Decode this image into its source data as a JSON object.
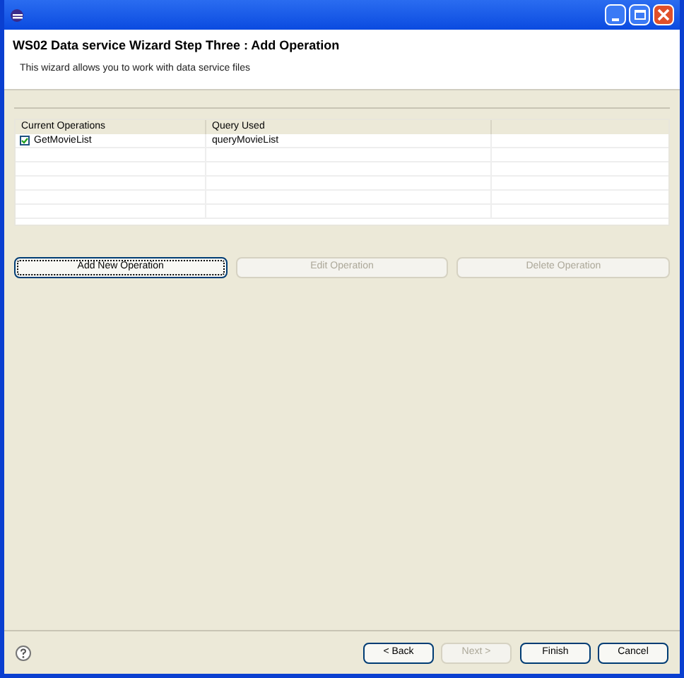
{
  "header": {
    "title": "WS02 Data service Wizard Step Three : Add Operation",
    "description": "This wizard allows you to work with data service files"
  },
  "table": {
    "columns": [
      "Current Operations",
      "Query Used"
    ],
    "rows": [
      {
        "checked": true,
        "cells": [
          "GetMovieList",
          "queryMovieList"
        ]
      }
    ]
  },
  "actions": [
    {
      "label": "Add New Operation",
      "disabled": false,
      "focused": true
    },
    {
      "label": "Edit Operation",
      "disabled": true,
      "focused": false
    },
    {
      "label": "Delete Operation",
      "disabled": true,
      "focused": false
    }
  ],
  "footer_buttons": [
    {
      "label": "< Back",
      "disabled": false
    },
    {
      "label": "Next >",
      "disabled": true
    },
    {
      "label": "Finish",
      "disabled": false
    },
    {
      "label": "Cancel",
      "disabled": false
    }
  ]
}
